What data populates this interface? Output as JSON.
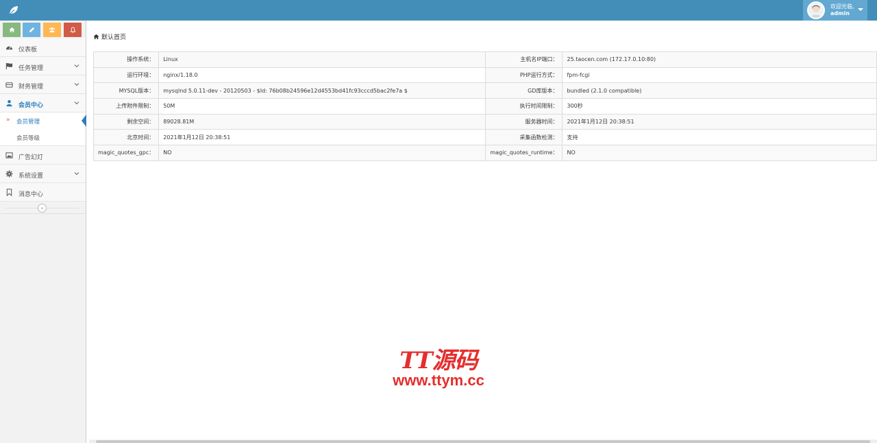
{
  "header": {
    "logo_icon": "leaf-icon",
    "welcome_text": "欢迎光临,",
    "username": "admin",
    "bg_color": "#438eb9"
  },
  "shortcuts": [
    {
      "icon": "home-icon",
      "color": "#87b87f"
    },
    {
      "icon": "pencil-icon",
      "color": "#6fb3e0"
    },
    {
      "icon": "users-icon",
      "color": "#ffb752"
    },
    {
      "icon": "bell-icon",
      "color": "#d15b47"
    }
  ],
  "sidebar": {
    "items": [
      {
        "label": "仪表板",
        "icon": "dashboard-icon"
      },
      {
        "label": "任务管理",
        "icon": "flag-icon"
      },
      {
        "label": "财务管理",
        "icon": "wallet-icon"
      },
      {
        "label": "会员中心",
        "icon": "user-icon"
      },
      {
        "label": "广告幻灯",
        "icon": "image-icon"
      },
      {
        "label": "系统设置",
        "icon": "gear-icon"
      },
      {
        "label": "消息中心",
        "icon": "bookmark-icon"
      }
    ],
    "submenu": [
      {
        "label": "会员管理"
      },
      {
        "label": "会员等级"
      }
    ],
    "collapse_icon": "«"
  },
  "breadcrumb": {
    "label": "默认首页"
  },
  "info": {
    "rows": [
      {
        "k1": "操作系统：",
        "v1": "Linux",
        "k2": "主机名IP端口：",
        "v2": "25.taocen.com (172.17.0.10:80)"
      },
      {
        "k1": "运行环境：",
        "v1": "nginx/1.18.0",
        "k2": "PHP运行方式：",
        "v2": "fpm-fcgi"
      },
      {
        "k1": "MYSQL版本：",
        "v1": "mysqlnd 5.0.11-dev - 20120503 - $Id: 76b08b24596e12d4553bd41fc93cccd5bac2fe7a $",
        "k2": "GD库版本：",
        "v2": "bundled (2.1.0 compatible)"
      },
      {
        "k1": "上传附件限制：",
        "v1": "50M",
        "k2": "执行时间限制：",
        "v2": "300秒"
      },
      {
        "k1": "剩余空间：",
        "v1": "89028.81M",
        "k2": "服务器时间：",
        "v2": "2021年1月12日 20:38:51"
      },
      {
        "k1": "北京时间：",
        "v1": "2021年1月12日 20:38:51",
        "k2": "采集函数检测：",
        "v2": "支持"
      },
      {
        "k1": "magic_quotes_gpc：",
        "v1": "NO",
        "k2": "magic_quotes_runtime：",
        "v2": "NO"
      }
    ]
  },
  "watermark": {
    "title": "TT源码",
    "url": "www.ttym.cc"
  }
}
